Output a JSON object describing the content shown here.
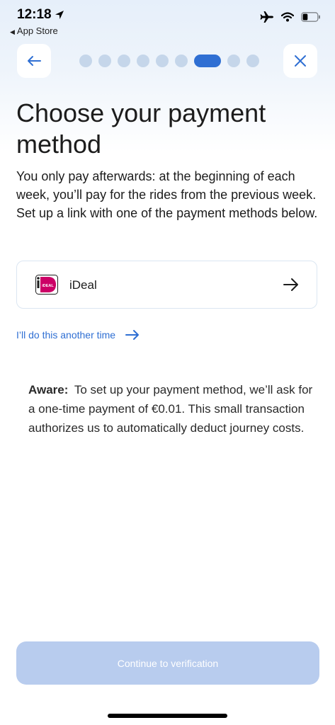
{
  "status_bar": {
    "time": "12:18",
    "back_app": "App Store",
    "battery_fraction": 0.35
  },
  "nav": {
    "back_icon": "arrow-left-icon",
    "close_icon": "close-icon",
    "progress_total": 9,
    "progress_current": 7
  },
  "title": "Choose your payment method",
  "subtitle": "You only pay afterwards: at the beginning of each week, you’ll pay for the rides from the previous week. Set up a link with one of the payment methods below.",
  "payment_methods": [
    {
      "label": "iDeal",
      "logo_text": "iDEAL",
      "icon": "ideal-logo-icon"
    }
  ],
  "later_link": "I’ll do this another time",
  "info": {
    "strong": "Aware:",
    "text": "To set up your payment method, we’ll ask for a one-time payment of €0.01. This small transaction authorizes us to automatically deduct journey costs."
  },
  "cta_label": "Continue to verification",
  "colors": {
    "accent": "#2f6fd3",
    "cta_disabled": "#b8ccee",
    "progress_inactive": "#c5d6ea",
    "ideal_pink": "#cc0066"
  }
}
